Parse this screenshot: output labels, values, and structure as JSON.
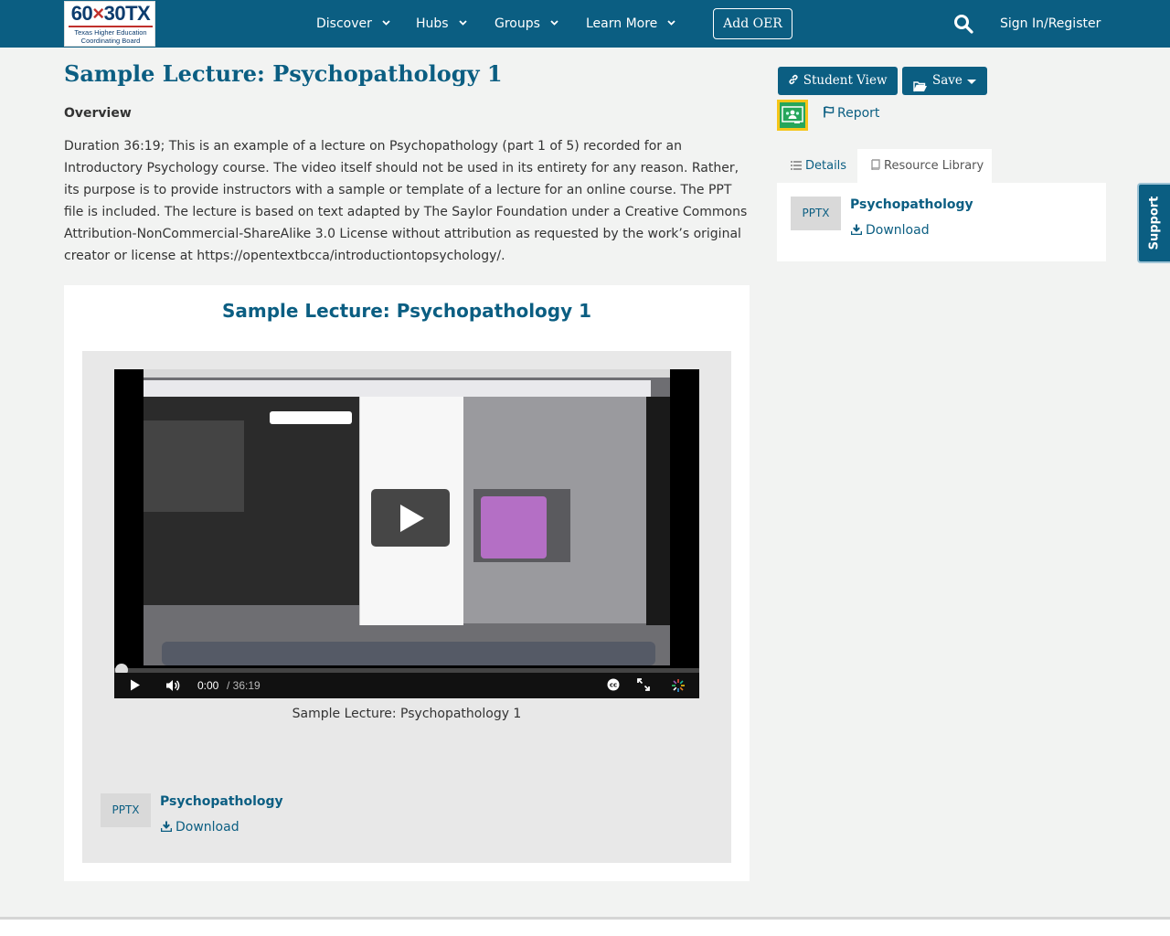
{
  "header": {
    "logo": {
      "big_a": "60",
      "big_x": "×",
      "big_b": "30TX",
      "line1": "Texas Higher Education",
      "line2": "Coordinating Board"
    },
    "nav": [
      {
        "label": "Discover"
      },
      {
        "label": "Hubs"
      },
      {
        "label": "Groups"
      },
      {
        "label": "Learn More"
      }
    ],
    "add_oer": "Add OER",
    "sign_in": "Sign In/Register",
    "colors": {
      "brand": "#0b5e82",
      "accent_red": "#c0302c"
    }
  },
  "page": {
    "title": "Sample Lecture: Psychopathology 1",
    "overview_label": "Overview",
    "overview_text": "Duration 36:19; This is an example of a lecture on Psychopathology (part 1 of 5) recorded for an Introductory Psychology course. The video itself should not be used in its entirety for any reason. Rather, its purpose is to provide instructors with a sample or template of a lecture for an online course. The PPT file is included. The lecture is based on text adapted by The Saylor Foundation under a Creative Commons Attribution-NonCommercial-ShareAlike 3.0 License without attribution as requested by the work’s original creator or license at https://opentextbcca/introductiontopsychology/."
  },
  "sidebar": {
    "student_view": "Student View",
    "save": "Save",
    "report": "Report",
    "tabs": [
      {
        "label": "Details",
        "active": false
      },
      {
        "label": "Resource Library",
        "active": true
      }
    ],
    "resource": {
      "badge": "PPTX",
      "name": "Psychopathology",
      "download": "Download"
    }
  },
  "main": {
    "card_title": "Sample Lecture: Psychopathology 1",
    "video": {
      "current_time": "0:00",
      "duration": "/ 36:19",
      "progress": 0
    },
    "caption": "Sample Lecture: Psychopathology 1",
    "file": {
      "badge": "PPTX",
      "name": "Psychopathology",
      "download": "Download"
    }
  },
  "support_tab": "Support"
}
